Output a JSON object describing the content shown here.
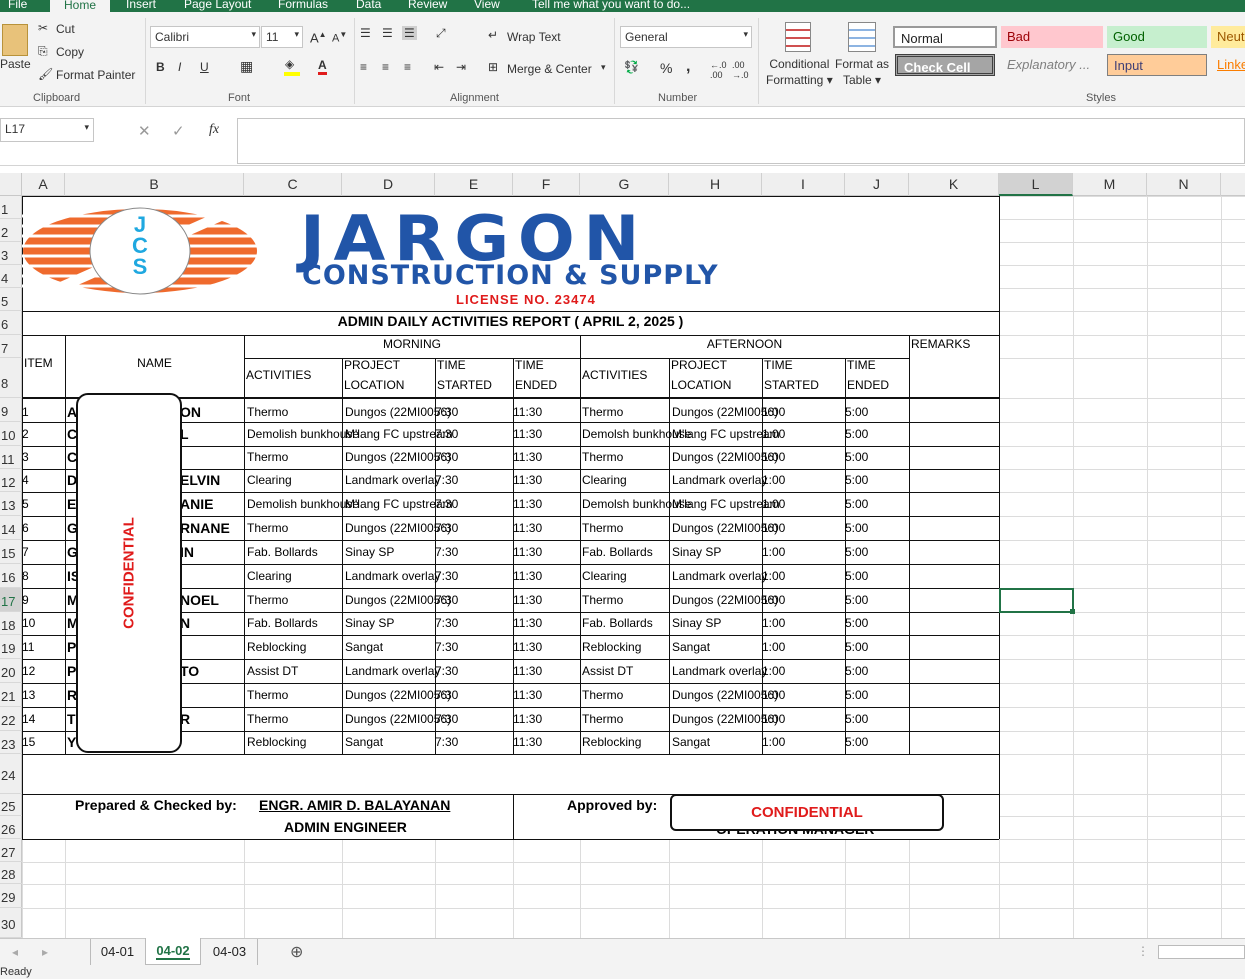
{
  "ribbon_tabs": [
    "File",
    "Home",
    "Insert",
    "Page Layout",
    "Formulas",
    "Data",
    "Review",
    "View",
    "Tell me what you want to do..."
  ],
  "clipboard": {
    "paste": "Paste",
    "cut": "Cut",
    "copy": "Copy",
    "format_painter": "Format Painter",
    "label": "Clipboard"
  },
  "font": {
    "name": "Calibri",
    "size": "11",
    "label": "Font"
  },
  "alignment": {
    "wrap": "Wrap Text",
    "merge": "Merge & Center",
    "label": "Alignment"
  },
  "number": {
    "format": "General",
    "label": "Number"
  },
  "styles": {
    "conditional_line1": "Conditional",
    "conditional_line2": "Formatting",
    "format_table_line1": "Format as",
    "format_table_line2": "Table",
    "normal": "Normal",
    "bad": "Bad",
    "good": "Good",
    "neutral": "Neut",
    "check_cell": "Check Cell",
    "explanatory": "Explanatory ...",
    "input": "Input",
    "linked": "Linke",
    "label": "Styles"
  },
  "formula_bar": {
    "name_box": "L17",
    "fx": "fx"
  },
  "columns": [
    "A",
    "B",
    "C",
    "D",
    "E",
    "F",
    "G",
    "H",
    "I",
    "J",
    "K",
    "L",
    "M",
    "N"
  ],
  "rows": [
    "1",
    "2",
    "3",
    "4",
    "5",
    "6",
    "7",
    "8",
    "9",
    "10",
    "11",
    "12",
    "13",
    "14",
    "15",
    "16",
    "17",
    "18",
    "19",
    "20",
    "21",
    "22",
    "23",
    "24",
    "25",
    "26",
    "27",
    "28",
    "29",
    "30"
  ],
  "company": {
    "name": "JARGON",
    "sub": "CONSTRUCTION & SUPPLY",
    "license": "LICENSE NO. 23474",
    "logo_letters": "JCS"
  },
  "report_title": "ADMIN DAILY ACTIVITIES REPORT ( APRIL 2, 2025 )",
  "headers": {
    "item": "ITEM",
    "name": "NAME",
    "morning": "MORNING",
    "afternoon": "AFTERNOON",
    "remarks": "REMARKS",
    "activities": "ACTIVITIES",
    "project_1": "PROJECT",
    "project_2": "LOCATION",
    "time_1": "TIME",
    "started": "STARTED",
    "ended": "ENDED"
  },
  "rows_data": [
    {
      "item": "1",
      "name_l": "A",
      "name_r": "ON",
      "am_act": "Thermo",
      "am_loc": "Dungos (22MI0056)",
      "am_s": "7:30",
      "am_e": "11:30",
      "pm_act": "Thermo",
      "pm_loc": "Dungos (22MI0056)",
      "pm_s": "1:00",
      "pm_e": "5:00"
    },
    {
      "item": "2",
      "name_l": "C",
      "name_r": "L",
      "am_act": "Demolish bunkhouse",
      "am_loc": "M'lang FC upstream",
      "am_s": "7:30",
      "am_e": "11:30",
      "pm_act": "Demolsh bunkhouse",
      "pm_loc": "M'lang FC upstream",
      "pm_s": "1:00",
      "pm_e": "5:00"
    },
    {
      "item": "3",
      "name_l": "C",
      "name_r": "",
      "am_act": "Thermo",
      "am_loc": "Dungos (22MI0056)",
      "am_s": "7:30",
      "am_e": "11:30",
      "pm_act": "Thermo",
      "pm_loc": "Dungos (22MI0056)",
      "pm_s": "1:00",
      "pm_e": "5:00"
    },
    {
      "item": "4",
      "name_l": "D",
      "name_r": "ELVIN",
      "am_act": "Clearing",
      "am_loc": "Landmark overlay",
      "am_s": "7:30",
      "am_e": "11:30",
      "pm_act": "Clearing",
      "pm_loc": "Landmark overlay",
      "pm_s": "1:00",
      "pm_e": "5:00"
    },
    {
      "item": "5",
      "name_l": "E",
      "name_r": "ANIE",
      "am_act": "Demolish bunkhouse",
      "am_loc": "M'lang FC upstream",
      "am_s": "7:30",
      "am_e": "11:30",
      "pm_act": "Demolsh bunkhouse",
      "pm_loc": "M'lang FC upstream",
      "pm_s": "1:00",
      "pm_e": "5:00"
    },
    {
      "item": "6",
      "name_l": "G",
      "name_r": "RNANE",
      "am_act": "Thermo",
      "am_loc": "Dungos (22MI0056)",
      "am_s": "7:30",
      "am_e": "11:30",
      "pm_act": "Thermo",
      "pm_loc": "Dungos (22MI0056)",
      "pm_s": "1:00",
      "pm_e": "5:00"
    },
    {
      "item": "7",
      "name_l": "G",
      "name_r": "IN",
      "am_act": "Fab. Bollards",
      "am_loc": "Sinay SP",
      "am_s": "7:30",
      "am_e": "11:30",
      "pm_act": "Fab. Bollards",
      "pm_loc": "Sinay SP",
      "pm_s": "1:00",
      "pm_e": "5:00"
    },
    {
      "item": "8",
      "name_l": "IS",
      "name_r": "",
      "am_act": "Clearing",
      "am_loc": "Landmark overlay",
      "am_s": "7:30",
      "am_e": "11:30",
      "pm_act": "Clearing",
      "pm_loc": "Landmark overlay",
      "pm_s": "1:00",
      "pm_e": "5:00"
    },
    {
      "item": "9",
      "name_l": "M",
      "name_r": "NOEL",
      "am_act": "Thermo",
      "am_loc": "Dungos (22MI0056)",
      "am_s": "7:30",
      "am_e": "11:30",
      "pm_act": "Thermo",
      "pm_loc": "Dungos (22MI0056)",
      "pm_s": "1:00",
      "pm_e": "5:00"
    },
    {
      "item": "10",
      "name_l": "M",
      "name_r": "N",
      "am_act": "Fab. Bollards",
      "am_loc": "Sinay SP",
      "am_s": "7:30",
      "am_e": "11:30",
      "pm_act": "Fab. Bollards",
      "pm_loc": "Sinay SP",
      "pm_s": "1:00",
      "pm_e": "5:00"
    },
    {
      "item": "11",
      "name_l": "P",
      "name_r": "",
      "am_act": "Reblocking",
      "am_loc": "Sangat",
      "am_s": "7:30",
      "am_e": "11:30",
      "pm_act": "Reblocking",
      "pm_loc": "Sangat",
      "pm_s": "1:00",
      "pm_e": "5:00"
    },
    {
      "item": "12",
      "name_l": "P",
      "name_r": "TO",
      "am_act": "Assist DT",
      "am_loc": "Landmark overlay",
      "am_s": "7:30",
      "am_e": "11:30",
      "pm_act": "Assist DT",
      "pm_loc": "Landmark overlay",
      "pm_s": "1:00",
      "pm_e": "5:00"
    },
    {
      "item": "13",
      "name_l": "R",
      "name_r": "",
      "am_act": "Thermo",
      "am_loc": "Dungos (22MI0056)",
      "am_s": "7:30",
      "am_e": "11:30",
      "pm_act": "Thermo",
      "pm_loc": "Dungos (22MI0056)",
      "pm_s": "1:00",
      "pm_e": "5:00"
    },
    {
      "item": "14",
      "name_l": "T",
      "name_r": "R",
      "am_act": "Thermo",
      "am_loc": "Dungos (22MI0056)",
      "am_s": "7:30",
      "am_e": "11:30",
      "pm_act": "Thermo",
      "pm_loc": "Dungos (22MI0056)",
      "pm_s": "1:00",
      "pm_e": "5:00"
    },
    {
      "item": "15",
      "name_l": "Y",
      "name_r": "",
      "am_act": "Reblocking",
      "am_loc": "Sangat",
      "am_s": "7:30",
      "am_e": "11:30",
      "pm_act": "Reblocking",
      "pm_loc": "Sangat",
      "pm_s": "1:00",
      "pm_e": "5:00"
    }
  ],
  "footer": {
    "prepared_label": "Prepared & Checked by:",
    "prepared_name": "ENGR. AMIR D. BALAYANAN",
    "prepared_title": "ADMIN ENGINEER",
    "approved_label": "Approved by:",
    "approved_title": "OPERATION MANAGER"
  },
  "confidential": "CONFIDENTIAL",
  "sheet_tabs": [
    "04-01",
    "04-02",
    "04-03"
  ],
  "active_sheet": "04-02",
  "status": "Ready",
  "colors": {
    "excel_green": "#217346",
    "jargon_blue": "#2155a8",
    "logo_orange": "#ef6a2d",
    "confidential_red": "#e01b1b"
  }
}
